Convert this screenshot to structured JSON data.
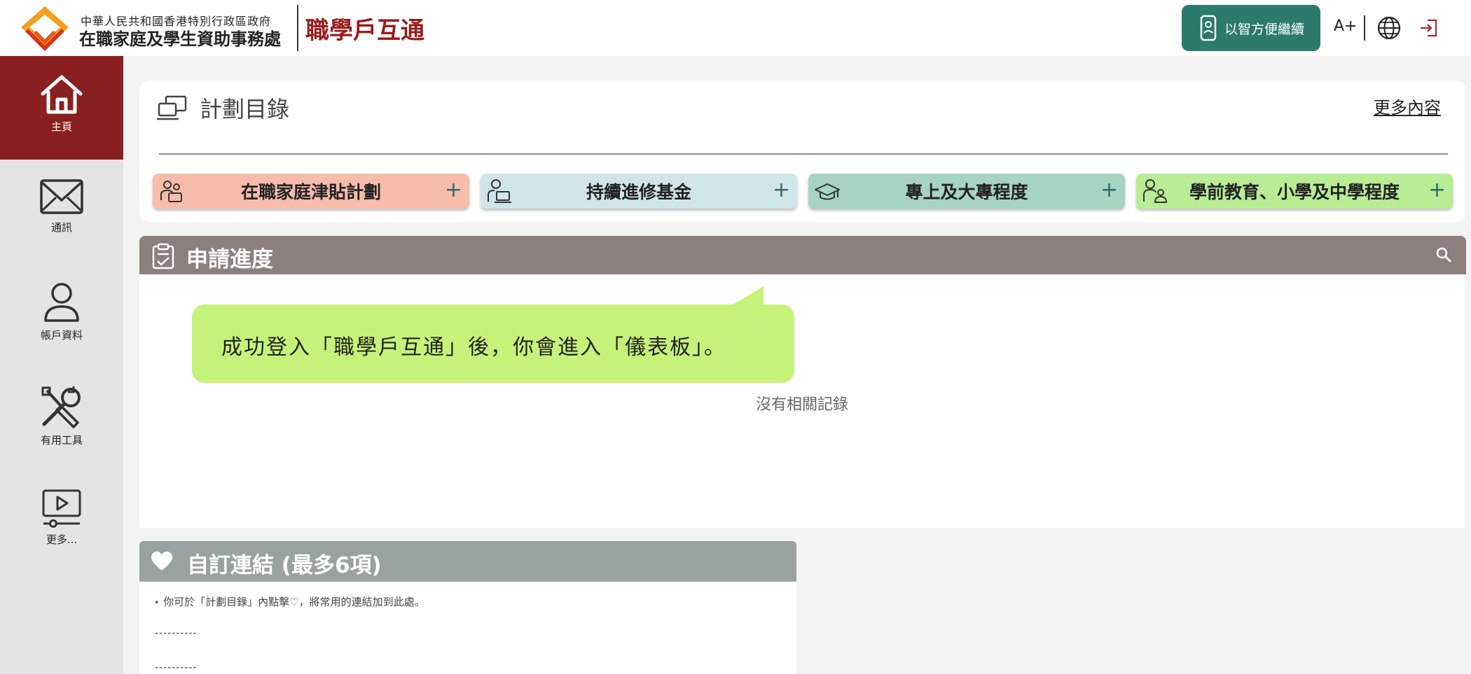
{
  "header": {
    "org_sub": "中華人民共和國香港特別行政區政府",
    "org_main": "在職家庭及學生資助事務處",
    "brand": "職學戶互通",
    "smart_button": "以智方便繼續",
    "font_size": "A+"
  },
  "sidebar": {
    "items": [
      {
        "label": "主頁",
        "icon": "home-icon",
        "active": true
      },
      {
        "label": "通訊",
        "icon": "mail-icon"
      },
      {
        "label": "帳戶資料",
        "icon": "user-icon"
      },
      {
        "label": "有用工具",
        "icon": "tools-icon"
      },
      {
        "label": "更多...",
        "icon": "video-icon"
      }
    ]
  },
  "plans": {
    "title": "計劃目錄",
    "more": "更多內容",
    "items": [
      {
        "label": "在職家庭津貼計劃",
        "color": "#f8bcab"
      },
      {
        "label": "持續進修基金",
        "color": "#cfe5ea"
      },
      {
        "label": "專上及大專程度",
        "color": "#a7d4c0"
      },
      {
        "label": "學前教育、小學及中學程度",
        "color": "#b8ed96"
      }
    ]
  },
  "progress": {
    "title": "申請進度",
    "empty": "沒有相關記錄"
  },
  "callout": {
    "text": "成功登入「職學戶互通」後，你會進入「儀表板」。"
  },
  "links": {
    "title": "自訂連結 (最多6項)",
    "hint": "⋆ 你可於「計劃目錄」內點擊♡，將常用的連結加到此處。",
    "placeholder1": "----------",
    "placeholder2": "----------"
  },
  "colors": {
    "brand": "#9b1b1b",
    "sidebar_active": "#8a1f1f",
    "smart_button": "#2b7a6d",
    "progress_header": "#8e7f7f",
    "links_header": "#9aa1a3",
    "callout": "#c6f27a"
  }
}
